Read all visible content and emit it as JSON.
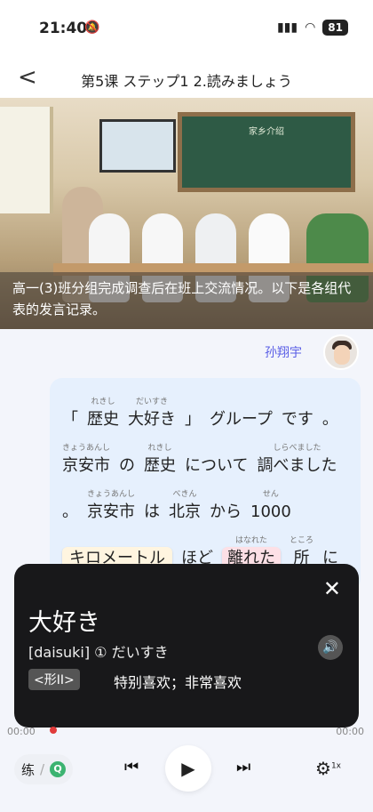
{
  "status": {
    "time": "21:40",
    "battery": "81"
  },
  "nav": {
    "back": "<",
    "title": "第5课 ステップ1 2.読みましょう"
  },
  "hero": {
    "board_text": "家乡介绍",
    "caption": "高一(3)班分组完成调查后在班上交流情况。以下是各组代表的发言记录。"
  },
  "speaker": {
    "name": "孙翔宇"
  },
  "text": {
    "line1": [
      {
        "r": "",
        "t": "「"
      },
      {
        "r": "れきし",
        "t": "歴史"
      },
      {
        "r": "だいすき",
        "t": "大好き"
      },
      {
        "r": "",
        "t": "」"
      },
      {
        "r": "",
        "t": "グループ"
      },
      {
        "r": "",
        "t": "です"
      },
      {
        "r": "",
        "t": "。"
      }
    ],
    "line2": [
      {
        "r": "きょうあんし",
        "t": "京安市"
      },
      {
        "r": "",
        "t": "の"
      },
      {
        "r": "れきし",
        "t": "歴史"
      },
      {
        "r": "",
        "t": "について"
      },
      {
        "r": "しらべました",
        "t": "調べました"
      }
    ],
    "line3": [
      {
        "r": "",
        "t": "。"
      },
      {
        "r": "きょうあんし",
        "t": "京安市"
      },
      {
        "r": "",
        "t": "は"
      },
      {
        "r": "べきん",
        "t": "北京"
      },
      {
        "r": "",
        "t": "から"
      },
      {
        "r": "せん",
        "t": "1000"
      }
    ],
    "line4": [
      {
        "r": "",
        "t": "キロメートル"
      },
      {
        "r": "",
        "t": "ほど"
      },
      {
        "r": "はなれた",
        "t": "離れた"
      },
      {
        "r": "ところ",
        "t": "所"
      },
      {
        "r": "",
        "t": "に"
      }
    ]
  },
  "popup": {
    "word": "大好き",
    "reading": "[daisuki] ① だいすき",
    "pos": "<形II>",
    "meaning": "特别喜欢；非常喜欢"
  },
  "player": {
    "current": "00:00",
    "total": "00:00",
    "mode": "练",
    "speed": "1x"
  }
}
